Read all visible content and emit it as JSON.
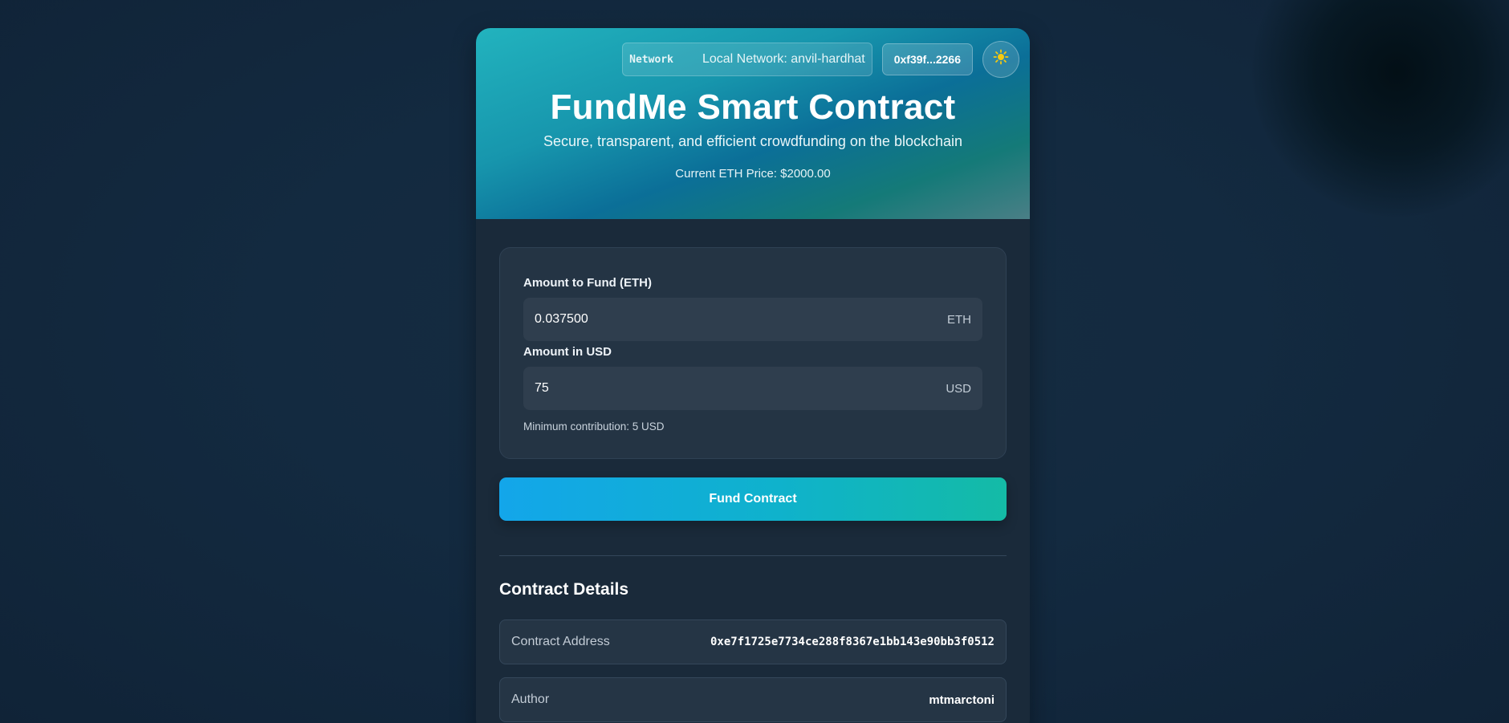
{
  "header": {
    "network_label": "Network",
    "network_value": "Local Network: anvil-hardhat",
    "account": "0xf39f...2266",
    "theme_icon": "sun-icon",
    "title": "FundMe Smart Contract",
    "subtitle": "Secure, transparent, and efficient crowdfunding on the blockchain",
    "eth_price": "Current ETH Price: $2000.00"
  },
  "form": {
    "eth_label": "Amount to Fund (ETH)",
    "eth_value": "0.037500",
    "eth_unit": "ETH",
    "usd_label": "Amount in USD",
    "usd_value": "75",
    "usd_unit": "USD",
    "hint": "Minimum contribution: 5 USD",
    "fund_button": "Fund Contract"
  },
  "details": {
    "title": "Contract Details",
    "rows": [
      {
        "key": "Contract Address",
        "value": "0xe7f1725e7734ce288f8367e1bb143e90bb3f0512"
      },
      {
        "key": "Author",
        "value": "mtmarctoni"
      }
    ]
  },
  "colors": {
    "accent_start": "#13a6ea",
    "accent_end": "#14bba6",
    "sun_icon": "#f6c90e"
  }
}
